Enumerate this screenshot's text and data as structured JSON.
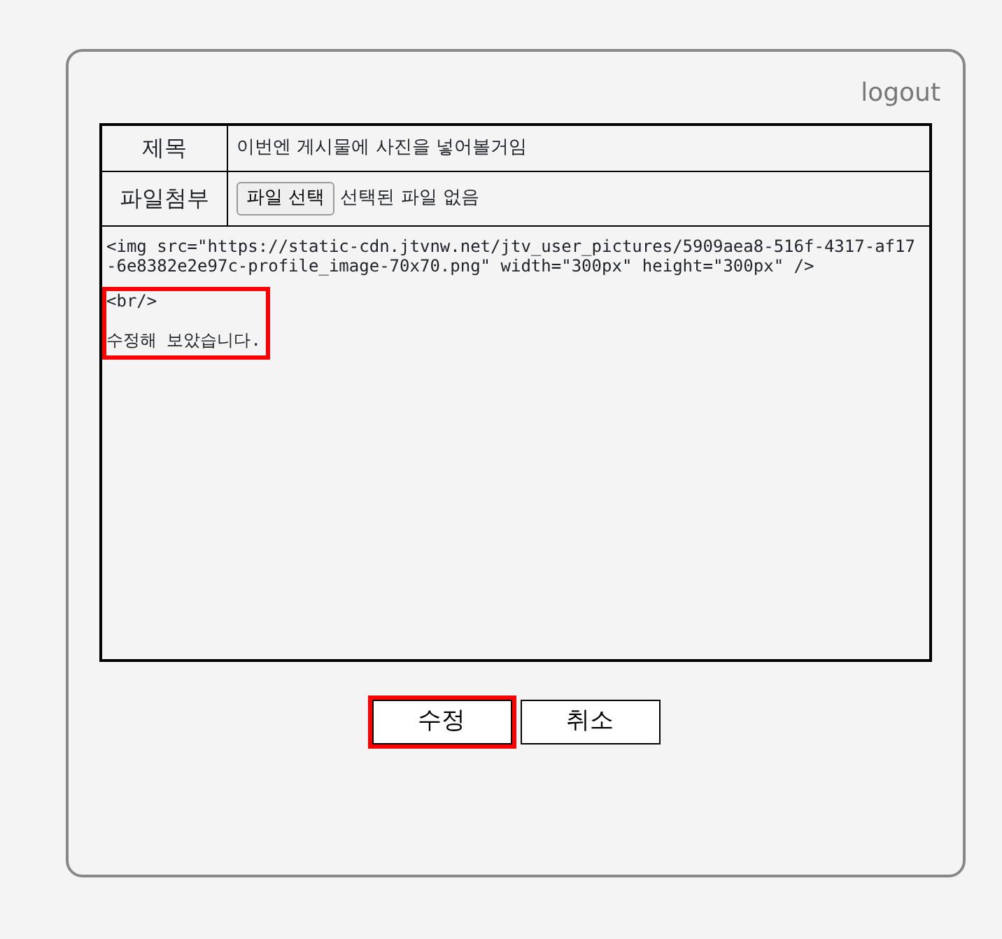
{
  "logout": "logout",
  "form": {
    "title_row": {
      "label": "제목",
      "value": "이번엔 게시물에 사진을 넣어볼거임"
    },
    "attachment_row": {
      "label": "파일첨부",
      "button": "파일 선택",
      "status": "선택된 파일 없음"
    },
    "content": {
      "lines": [
        {
          "text": "<img src=\"https://static-cdn.jtvnw.net/jtv_user_pictures/5909aea8-516f-4317-af17-6e8382e2e97c-profile_image-70x70.png\" width=\"300px\" height=\"300px\" />",
          "highlighted": false
        },
        {
          "text": "<br/>",
          "highlighted": true
        },
        {
          "text": "수정해 보았습니다.",
          "highlighted": true
        }
      ]
    }
  },
  "buttons": [
    {
      "label": "수정",
      "highlighted": true
    },
    {
      "label": "취소",
      "highlighted": false
    }
  ]
}
